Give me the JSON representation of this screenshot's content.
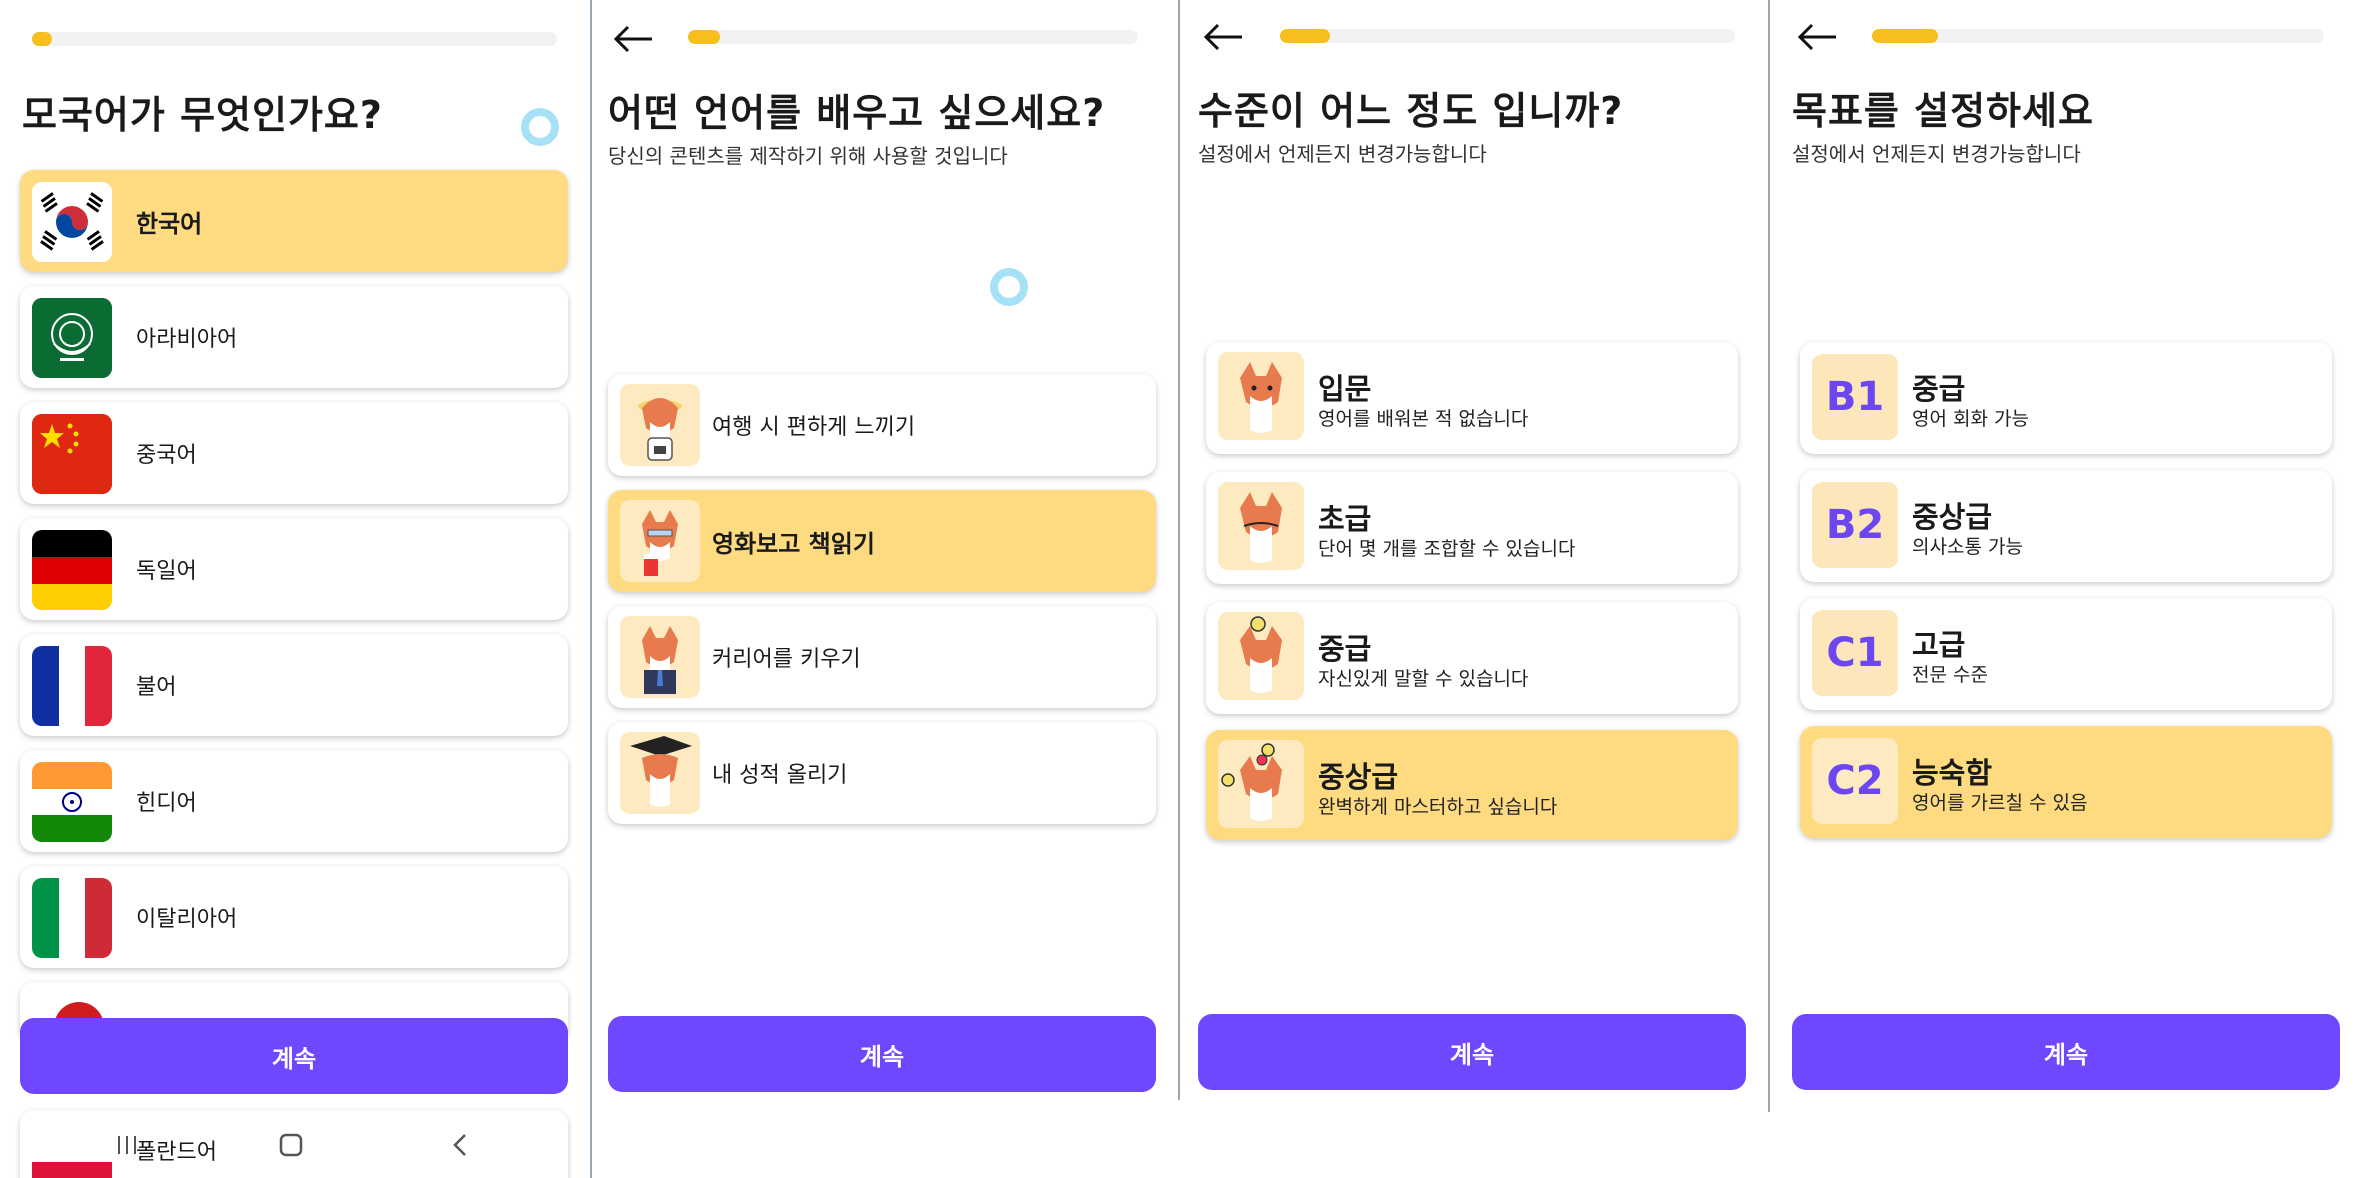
{
  "screens": {
    "native": {
      "title": "모국어가 무엇인가요?",
      "languages": [
        {
          "label": "한국어",
          "flag": "korea-flag-icon"
        },
        {
          "label": "아라비아어",
          "flag": "arab-league-flag-icon"
        },
        {
          "label": "중국어",
          "flag": "china-flag-icon"
        },
        {
          "label": "독일어",
          "flag": "germany-flag-icon"
        },
        {
          "label": "불어",
          "flag": "france-flag-icon"
        },
        {
          "label": "힌디어",
          "flag": "india-flag-icon"
        },
        {
          "label": "이탈리아어",
          "flag": "italy-flag-icon"
        },
        {
          "label": "폴란드어",
          "flag": "poland-flag-icon"
        }
      ],
      "selected": "한국어",
      "continue_label": "계속",
      "progress": 0.05
    },
    "purpose": {
      "title": "어떤 언어를 배우고 싶으세요?",
      "subtitle": "당신의 콘텐츠를 제작하기 위해 사용할 것입니다",
      "options": [
        {
          "label": "여행 시 편하게 느끼기",
          "icon": "corgi-traveler-icon"
        },
        {
          "label": "영화보고 책읽기",
          "icon": "corgi-popcorn-icon"
        },
        {
          "label": "커리어를 키우기",
          "icon": "corgi-business-icon"
        },
        {
          "label": "내 성적 올리기",
          "icon": "corgi-graduate-icon"
        }
      ],
      "selected": "영화보고 책읽기",
      "continue_label": "계속",
      "progress": 0.07
    },
    "level": {
      "title": "수준이 어느 정도 입니까?",
      "subtitle": "설정에서 언제든지 변경가능합니다",
      "options": [
        {
          "title": "입문",
          "desc": "영어를 배워본 적 없습니다"
        },
        {
          "title": "초급",
          "desc": "단어 몇 개를 조합할 수 있습니다"
        },
        {
          "title": "중급",
          "desc": "자신있게 말할 수 있습니다"
        },
        {
          "title": "중상급",
          "desc": "완벽하게 마스터하고 싶습니다"
        }
      ],
      "selected": "중상급",
      "continue_label": "계속",
      "progress": 0.1
    },
    "goal": {
      "title": "목표를 설정하세요",
      "subtitle": "설정에서 언제든지 변경가능합니다",
      "options": [
        {
          "code": "B1",
          "title": "중급",
          "desc": "영어 회화 가능"
        },
        {
          "code": "B2",
          "title": "중상급",
          "desc": "의사소통 가능"
        },
        {
          "code": "C1",
          "title": "고급",
          "desc": "전문 수준"
        },
        {
          "code": "C2",
          "title": "능숙함",
          "desc": "영어를 가르칠 수 있음"
        }
      ],
      "selected": "C2",
      "continue_label": "계속",
      "progress": 0.14
    }
  },
  "colors": {
    "accent": "#6f47ff",
    "selected_bg": "#fedb80",
    "progress": "#f7be1f"
  }
}
